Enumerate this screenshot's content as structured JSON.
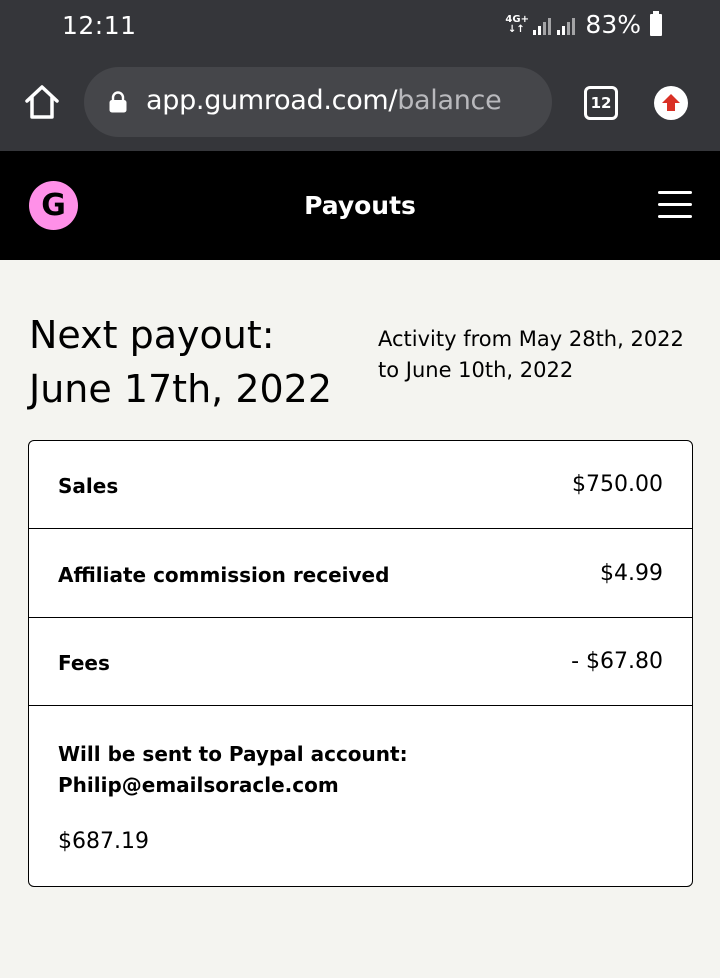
{
  "status_bar": {
    "time": "12:11",
    "network_type": "4G+",
    "battery_percent": "83%"
  },
  "browser": {
    "url_host": "app.gumroad.com/",
    "url_path": "balance",
    "tab_count": "12",
    "icons": [
      "home-icon",
      "lock-icon",
      "tabs-icon",
      "update-arrow-icon"
    ]
  },
  "app_header": {
    "logo_letter": "G",
    "title": "Payouts",
    "logo_color": "#ff90e8"
  },
  "main": {
    "next_payout_label": "Next payout:",
    "next_payout_date": "June 17th, 2022",
    "activity_range": "Activity from May 28th, 2022 to June 10th, 2022",
    "rows": [
      {
        "label": "Sales",
        "value": "$750.00"
      },
      {
        "label": "Affiliate commission received",
        "value": "$4.99"
      },
      {
        "label": "Fees",
        "value": "- $67.80"
      }
    ],
    "payout_destination_label": "Will be sent to Paypal account:",
    "payout_destination_email": "Philip@emailsoracle.com",
    "payout_amount": "$687.19"
  }
}
